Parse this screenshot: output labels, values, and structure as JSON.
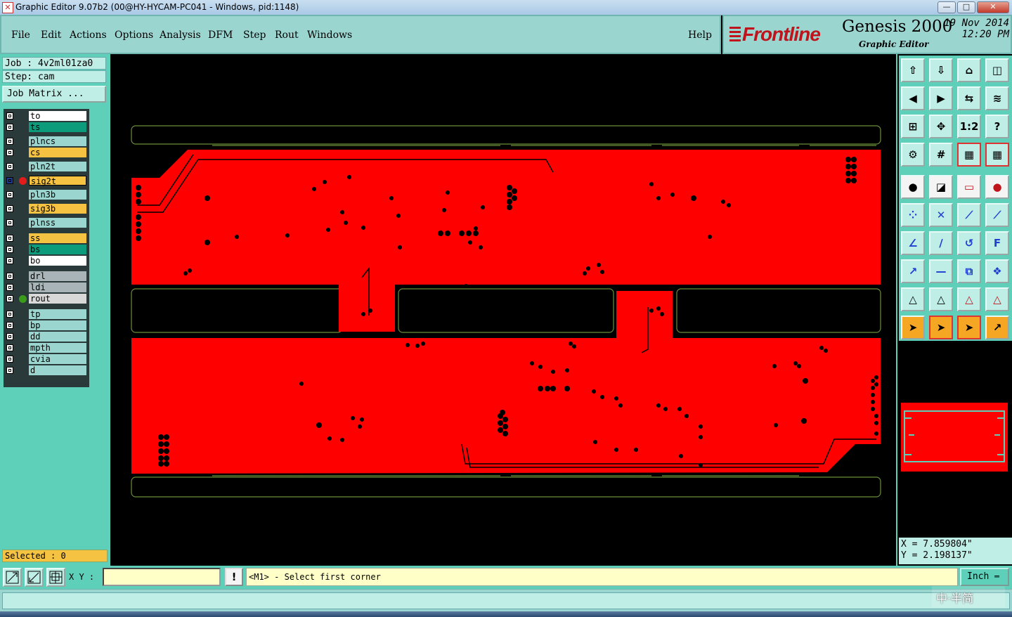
{
  "window": {
    "title": "Graphic Editor 9.07b2 (00@HY-HYCAM-PC041 - Windows, pid:1148)",
    "minimize": "—",
    "maximize": "□",
    "close": "✕"
  },
  "menu": {
    "items": [
      "File",
      "Edit",
      "Actions",
      "Options",
      "Analysis",
      "DFM",
      "Step",
      "Rout",
      "Windows"
    ],
    "help": "Help"
  },
  "brand": {
    "logo": "Frontline",
    "product": "Genesis 2000",
    "subtitle": "Graphic Editor",
    "date": "19 Nov 2014",
    "time": "12:20 PM"
  },
  "job": {
    "job_line": "Job : 4v2ml01za0",
    "step_line": "Step: cam",
    "matrix_button": "Job Matrix ..."
  },
  "layers": [
    {
      "name": "to",
      "color": "#ffffff",
      "mark": ""
    },
    {
      "name": "ts",
      "color": "#0c9c7c",
      "mark": ""
    },
    {
      "name": "plncs",
      "color": "#9bd5d0",
      "mark": ""
    },
    {
      "name": "cs",
      "color": "#f5c242",
      "mark": ""
    },
    {
      "name": "pln2t",
      "color": "#9bd5d0",
      "mark": ""
    },
    {
      "name": "sig2t",
      "color": "#f5c242",
      "mark": "red",
      "active": true
    },
    {
      "name": "pln3b",
      "color": "#9bd5d0",
      "mark": ""
    },
    {
      "name": "sig3b",
      "color": "#f5c242",
      "mark": ""
    },
    {
      "name": "plnss",
      "color": "#9bd5d0",
      "mark": ""
    },
    {
      "name": "ss",
      "color": "#f5c242",
      "mark": ""
    },
    {
      "name": "bs",
      "color": "#0c9c7c",
      "mark": ""
    },
    {
      "name": "bo",
      "color": "#ffffff",
      "mark": ""
    },
    {
      "name": "drl",
      "color": "#a8b4b8",
      "mark": ""
    },
    {
      "name": "ldi",
      "color": "#a8b4b8",
      "mark": ""
    },
    {
      "name": "rout",
      "color": "#d8d8d8",
      "mark": "green"
    },
    {
      "name": "tp",
      "color": "#9bd5d0",
      "mark": ""
    },
    {
      "name": "bp",
      "color": "#9bd5d0",
      "mark": ""
    },
    {
      "name": "dd",
      "color": "#9bd5d0",
      "mark": ""
    },
    {
      "name": "mpth",
      "color": "#9bd5d0",
      "mark": ""
    },
    {
      "name": "cvia",
      "color": "#9bd5d0",
      "mark": ""
    },
    {
      "name": "d",
      "color": "#9bd5d0",
      "mark": ""
    }
  ],
  "selected_text": "Selected : 0",
  "coords": {
    "x": "X = 7.859804\"",
    "y": "Y = 2.198137\""
  },
  "bottom": {
    "xy_label": "X Y :",
    "xy_value": "",
    "warn": "!",
    "prompt": "<M1> - Select first corner",
    "unit": "Inch"
  },
  "ime": "中·半简",
  "colors": {
    "panel": "#5ecfb8",
    "menu": "#9bd5d0",
    "copper": "#ff0000",
    "outline": "#6b8e3a"
  }
}
